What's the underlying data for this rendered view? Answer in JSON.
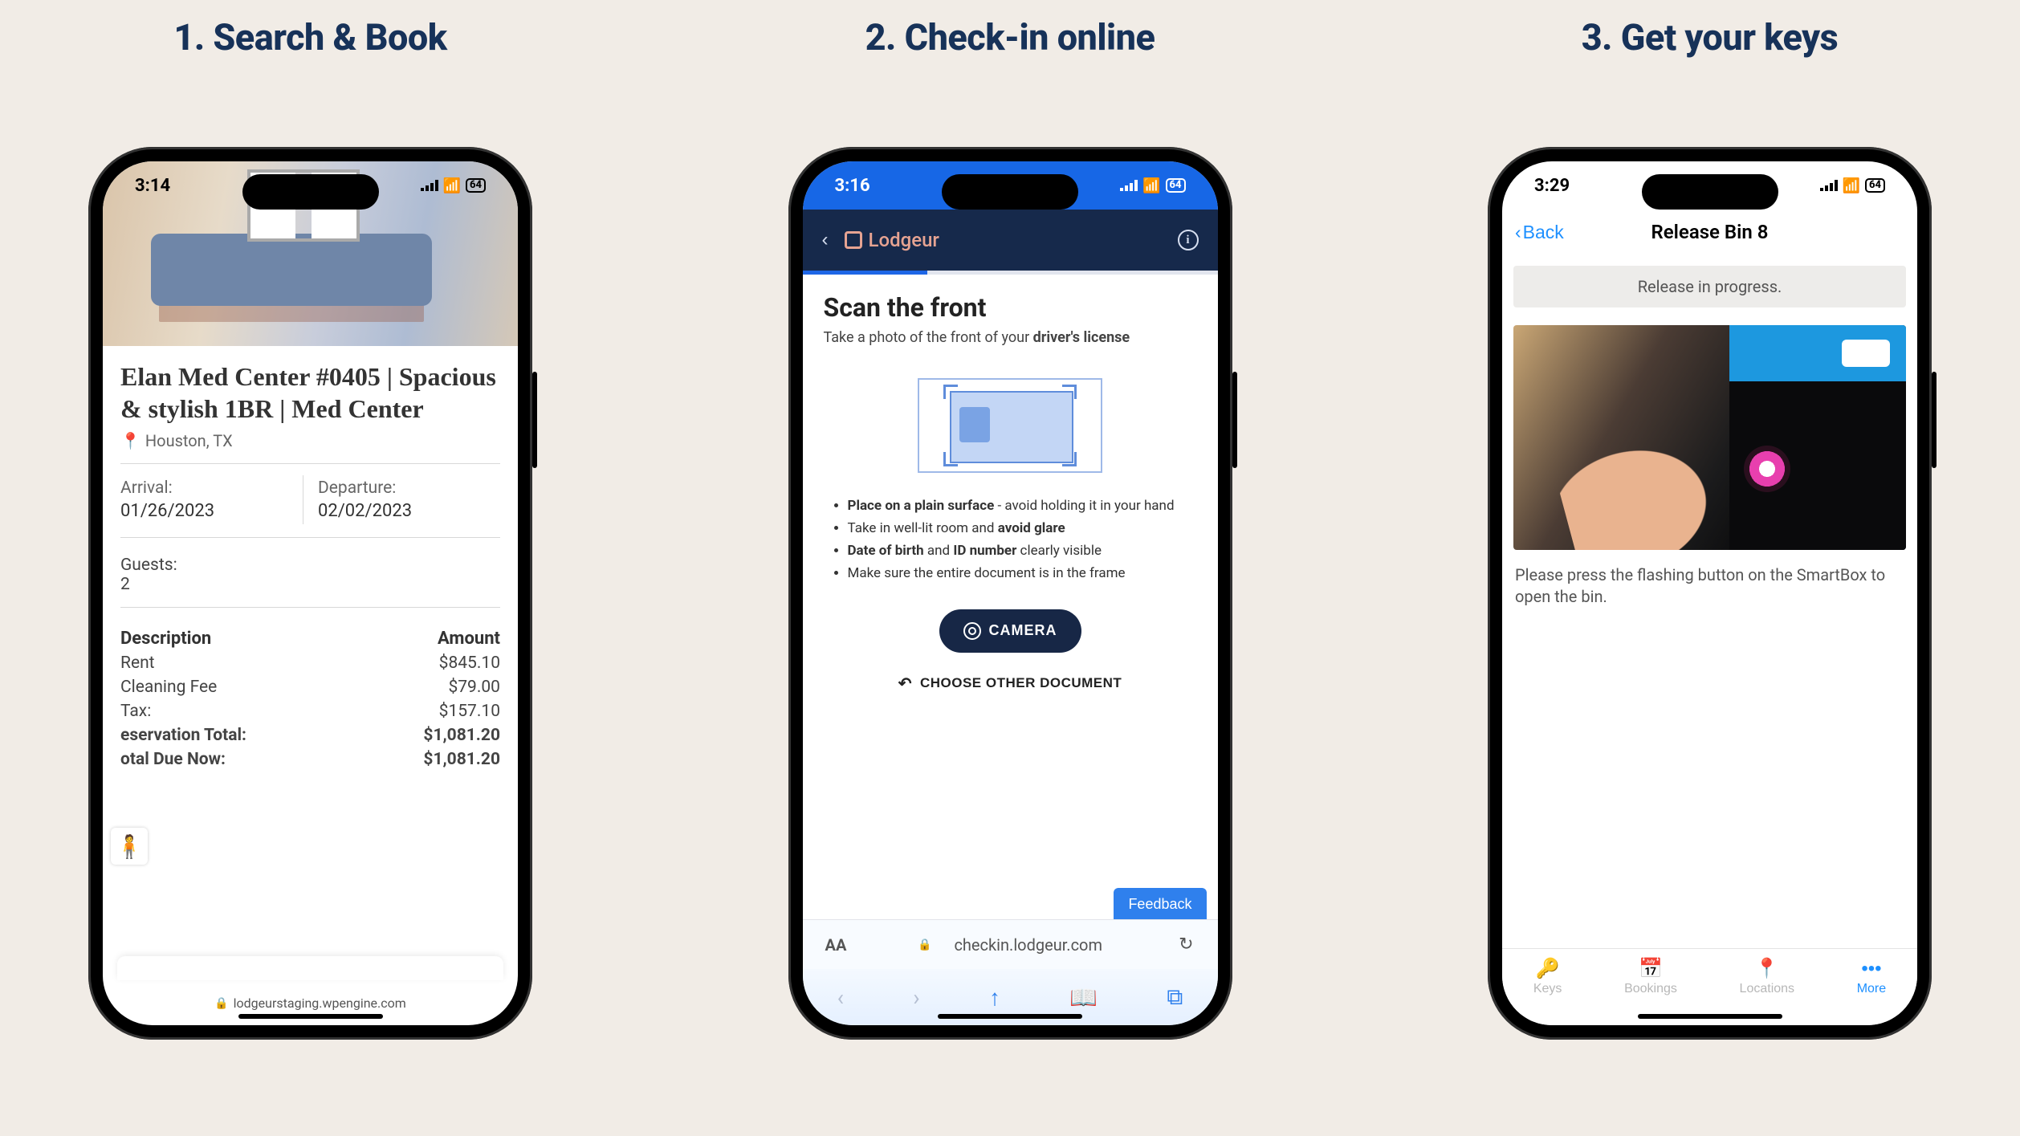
{
  "steps": {
    "s1": "1. Search & Book",
    "s2": "2. Check-in online",
    "s3": "3. Get your keys"
  },
  "phone1": {
    "status_time": "3:14",
    "battery": "64",
    "listing_title": "Elan Med Center #0405 | Spacious & stylish 1BR | Med Center",
    "location": "Houston, TX",
    "arrival_label": "Arrival:",
    "arrival_value": "01/26/2023",
    "departure_label": "Departure:",
    "departure_value": "02/02/2023",
    "guests_label": "Guests:",
    "guests_value": "2",
    "desc_header": "Description",
    "amount_header": "Amount",
    "rows": {
      "rent_l": "Rent",
      "rent_v": "$845.10",
      "clean_l": "Cleaning Fee",
      "clean_v": "$79.00",
      "tax_l": "Tax:",
      "tax_v": "$157.10",
      "rtot_l": "eservation Total:",
      "rtot_v": "$1,081.20",
      "due_l": "otal Due Now:",
      "due_v": "$1,081.20"
    },
    "url": "lodgeurstaging.wpengine.com"
  },
  "phone2": {
    "status_time": "3:16",
    "battery": "64",
    "brand": "Lodgeur",
    "title": "Scan the front",
    "subtitle_pre": "Take a photo of the front of your ",
    "subtitle_bold": "driver's license",
    "tips": {
      "t1a": "Place on a plain surface",
      "t1b": " - avoid holding it in your hand",
      "t2a": "Take in well-lit room and ",
      "t2b": "avoid glare",
      "t3a": "Date of birth",
      "t3b": " and ",
      "t3c": "ID number",
      "t3d": " clearly visible",
      "t4": "Make sure the entire document is in the frame"
    },
    "camera_btn": "CAMERA",
    "choose_other": "CHOOSE OTHER DOCUMENT",
    "feedback": "Feedback",
    "url": "checkin.lodgeur.com",
    "aA": "AA"
  },
  "phone3": {
    "status_time": "3:29",
    "battery": "64",
    "back": "Back",
    "title": "Release Bin 8",
    "banner": "Release in progress.",
    "caption": "Please press the flashing button on the SmartBox to open the bin.",
    "tabs": {
      "keys": "Keys",
      "bookings": "Bookings",
      "locations": "Locations",
      "more": "More"
    }
  }
}
